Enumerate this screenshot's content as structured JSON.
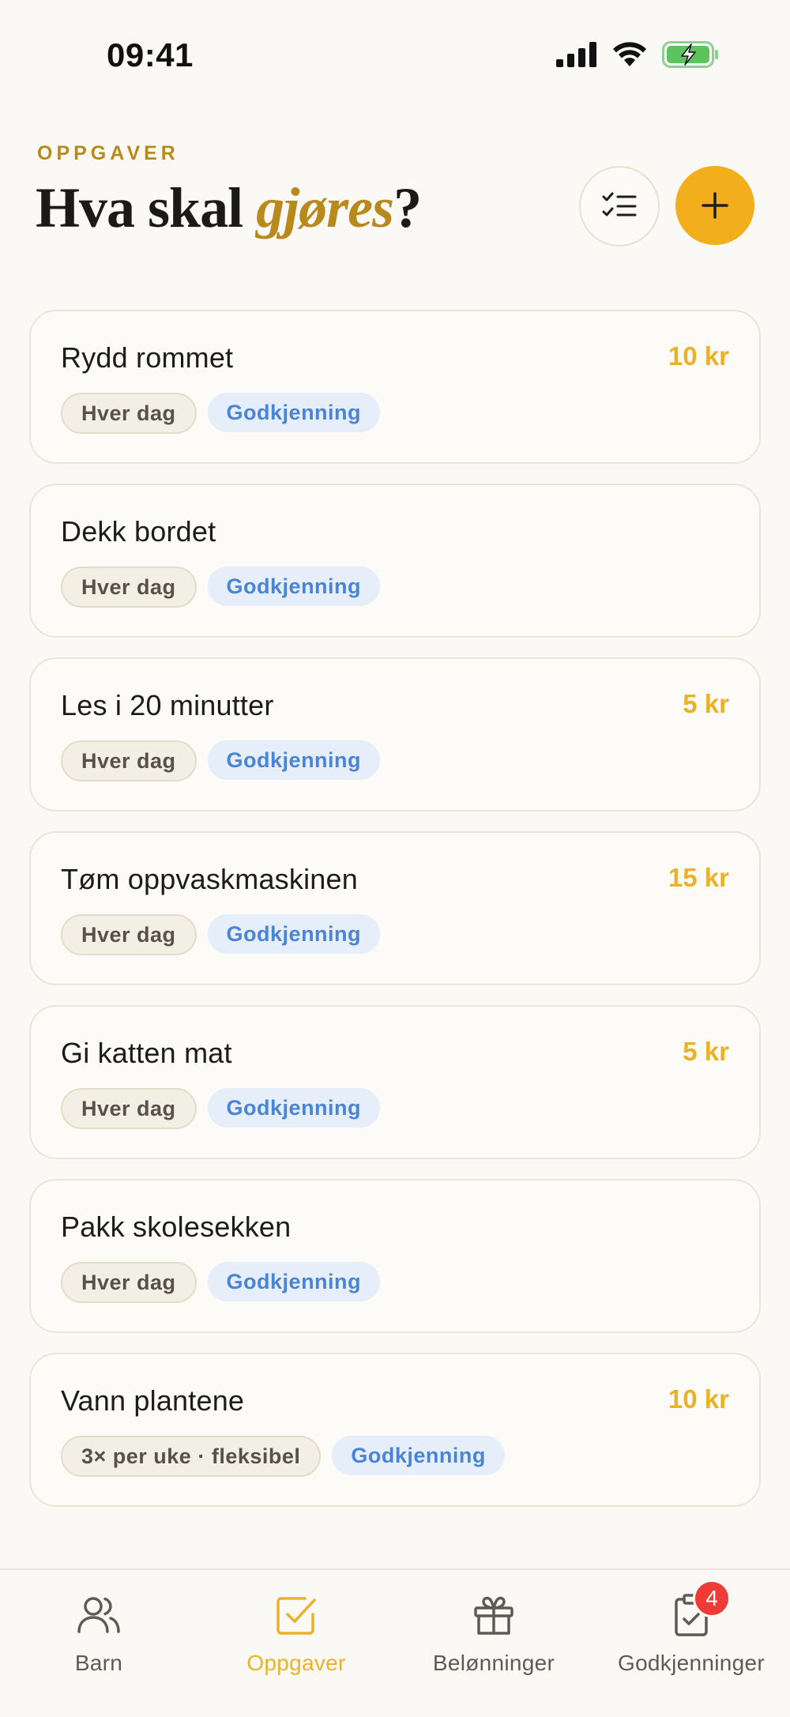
{
  "status_bar": {
    "time": "09:41"
  },
  "header": {
    "eyebrow": "OPPGAVER",
    "title_start": "Hva skal ",
    "title_accent": "gjøres",
    "title_end": "?"
  },
  "colors": {
    "accent": "#f2ae1c",
    "reward": "#eab22a",
    "approval_text": "#4a84d6",
    "badge": "#ef3b36"
  },
  "tasks": [
    {
      "title": "Rydd rommet",
      "reward": "10 kr",
      "frequency": "Hver dag",
      "approval": "Godkjenning"
    },
    {
      "title": "Dekk bordet",
      "reward": "",
      "frequency": "Hver dag",
      "approval": "Godkjenning"
    },
    {
      "title": "Les i 20 minutter",
      "reward": "5 kr",
      "frequency": "Hver dag",
      "approval": "Godkjenning"
    },
    {
      "title": "Tøm oppvaskmaskinen",
      "reward": "15 kr",
      "frequency": "Hver dag",
      "approval": "Godkjenning"
    },
    {
      "title": "Gi katten mat",
      "reward": "5 kr",
      "frequency": "Hver dag",
      "approval": "Godkjenning"
    },
    {
      "title": "Pakk skolesekken",
      "reward": "",
      "frequency": "Hver dag",
      "approval": "Godkjenning"
    },
    {
      "title": "Vann plantene",
      "reward": "10 kr",
      "frequency": "3× per uke · fleksibel",
      "approval": "Godkjenning"
    }
  ],
  "tabs": [
    {
      "label": "Barn",
      "icon": "users-icon",
      "active": false
    },
    {
      "label": "Oppgaver",
      "icon": "checkbox-icon",
      "active": true
    },
    {
      "label": "Belønninger",
      "icon": "gift-icon",
      "active": false
    },
    {
      "label": "Godkjenninger",
      "icon": "clipboard-check-icon",
      "active": false,
      "badge": "4"
    }
  ]
}
